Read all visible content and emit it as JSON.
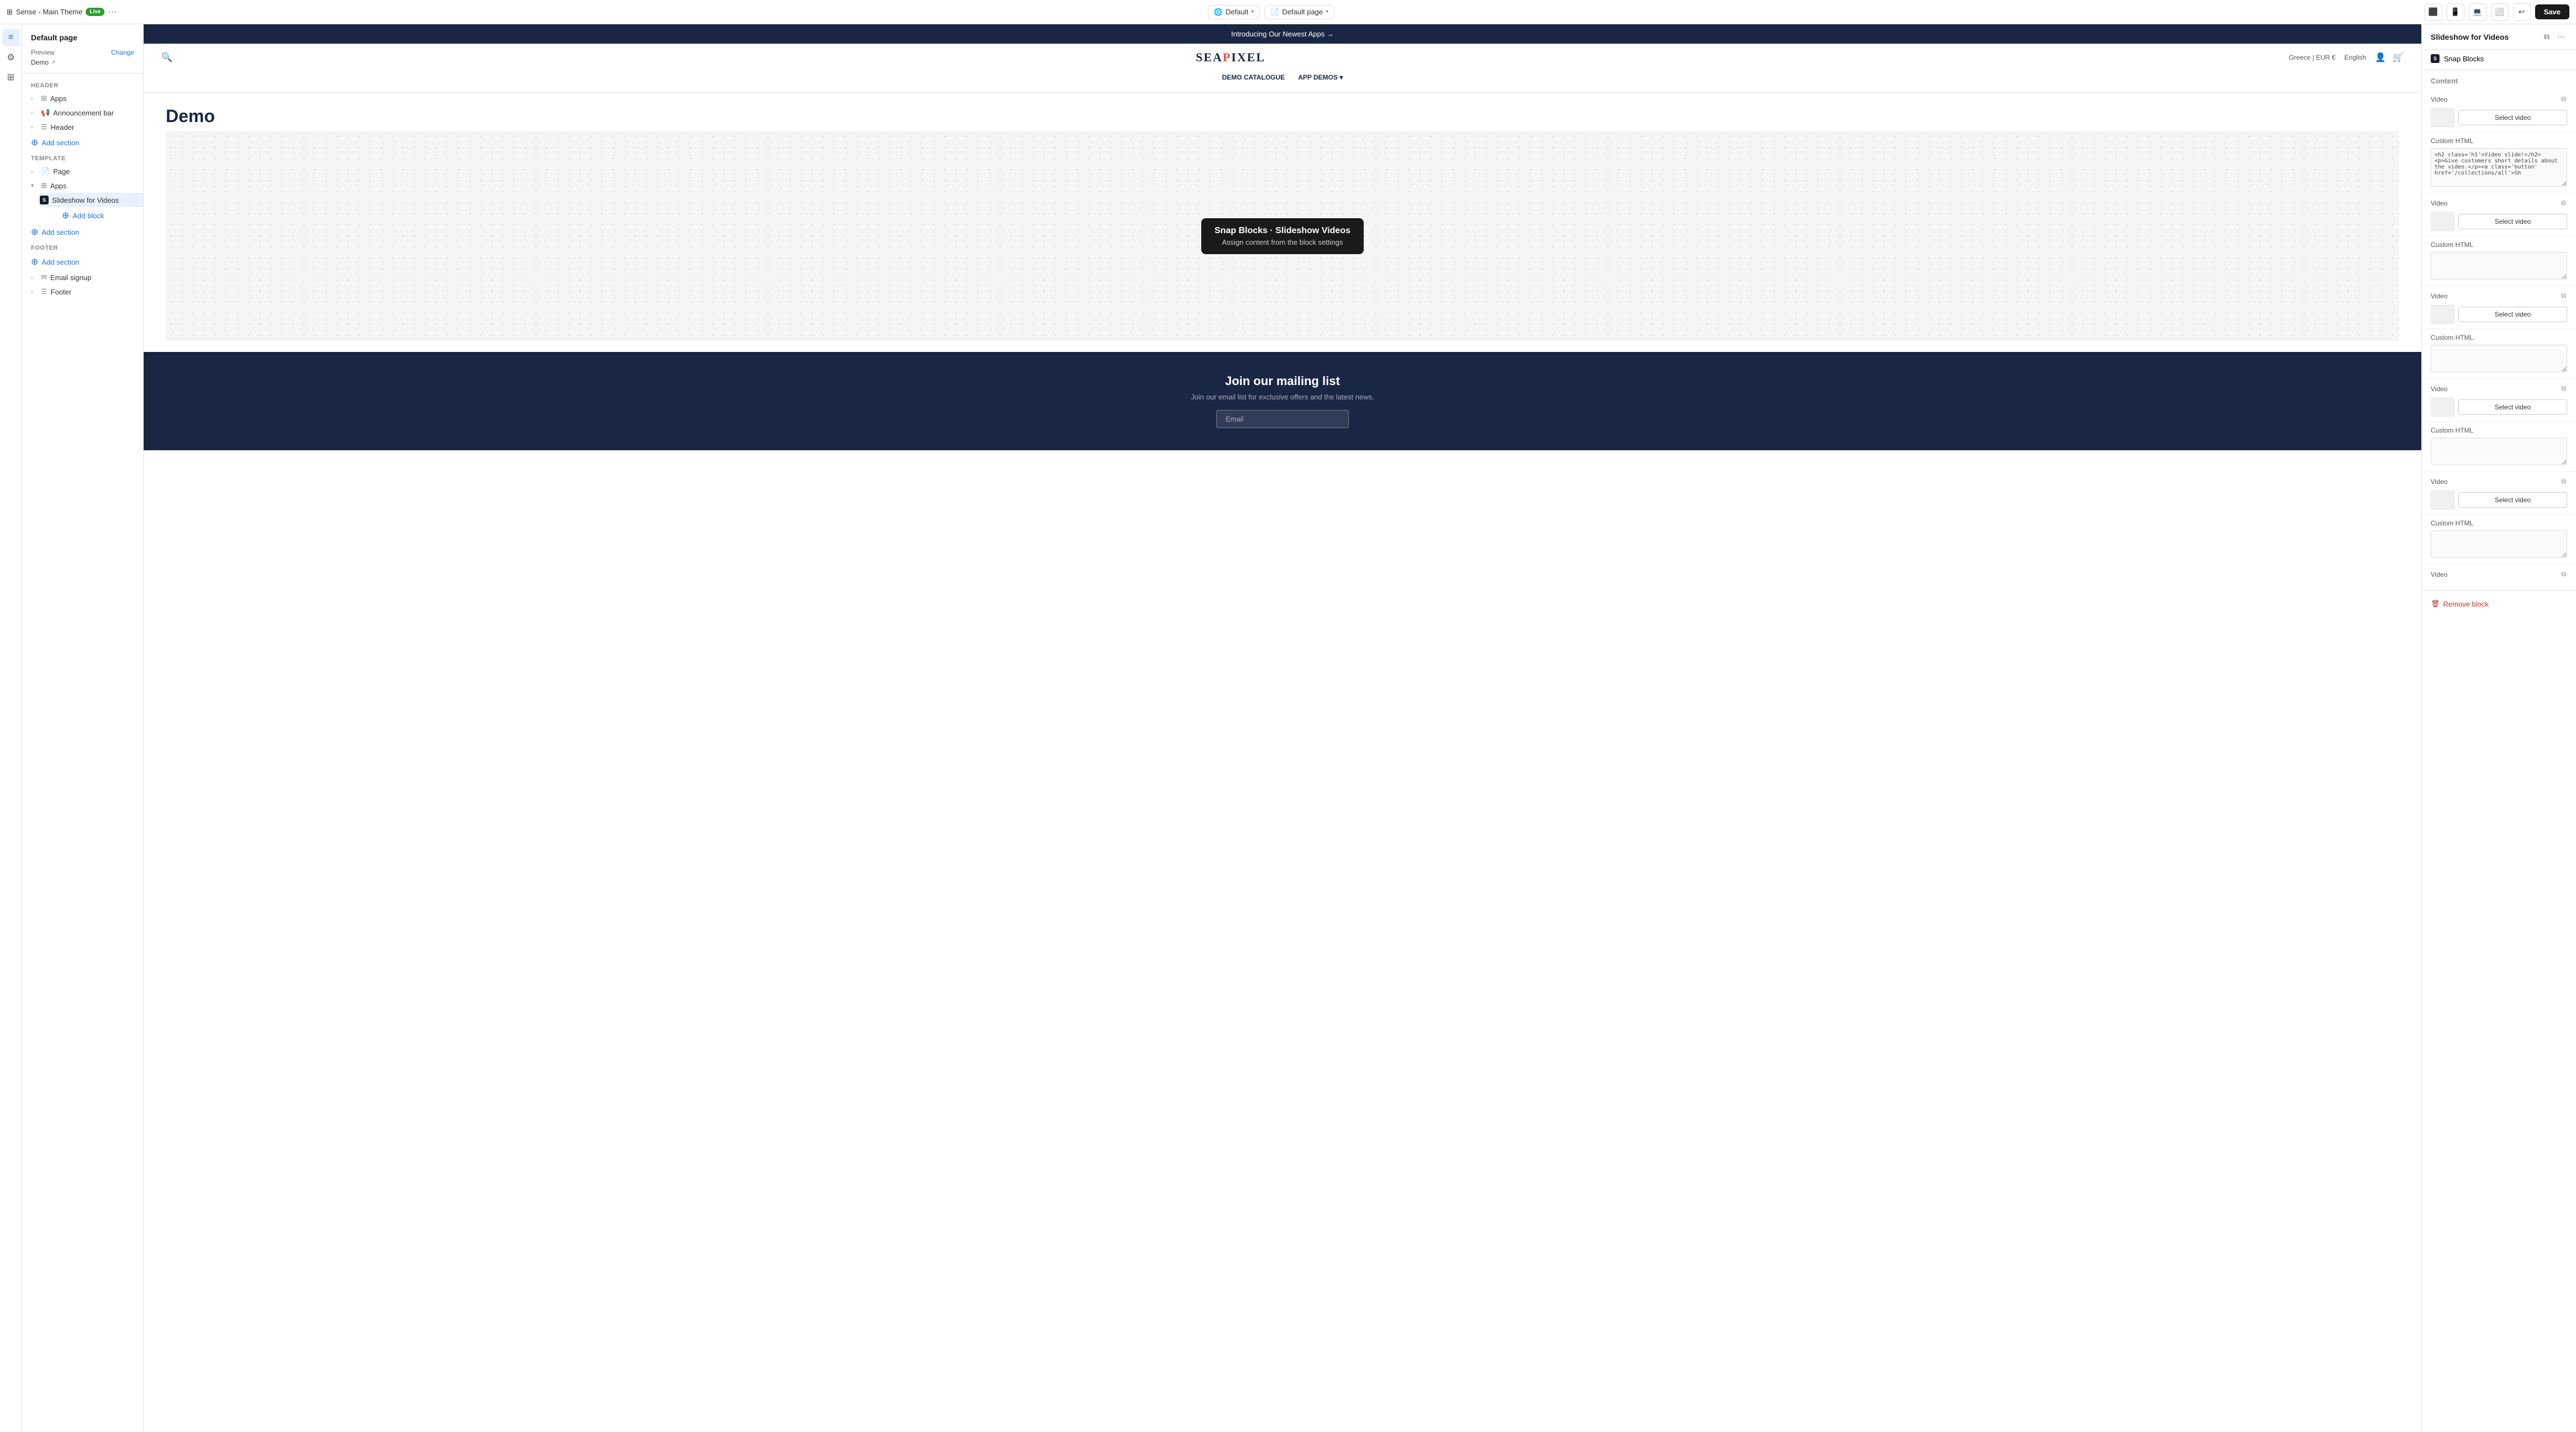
{
  "topbar": {
    "theme_name": "Sense - Main Theme",
    "live_label": "Live",
    "more_icon": "⋯",
    "default_label": "Default",
    "default_page_label": "Default page",
    "save_label": "Save",
    "undo_icon": "↩",
    "view_icons": [
      "⬛",
      "📱",
      "💻",
      "⬜"
    ]
  },
  "left_panel": {
    "title": "Default page",
    "preview_label": "Preview",
    "change_label": "Change",
    "demo_label": "Demo",
    "header_section": "Header",
    "apps_item": "Apps",
    "announcement_bar": "Announcement bar",
    "header_item": "Header",
    "add_section_1": "Add section",
    "template_label": "Template",
    "page_item": "Page",
    "apps_template": "Apps",
    "slideshow_videos": "Slideshow for Videos",
    "add_block": "Add block",
    "add_section_2": "Add section",
    "footer_label": "Footer",
    "add_section_footer": "Add section",
    "email_signup": "Email signup",
    "footer_item": "Footer"
  },
  "store": {
    "announcement": "Introducing Our Newest Apps →",
    "logo": "SEAPIXEL",
    "region": "Greece | EUR €",
    "language": "English",
    "nav": [
      "DEMO CATALOGUE",
      "APP DEMOS"
    ],
    "demo_title": "Demo",
    "slideshow_tooltip_title": "Snap Blocks · Slideshow Videos",
    "slideshow_tooltip_sub": "Assign content from the block settings",
    "mailing_title": "Join our mailing list",
    "mailing_sub": "Join our email list for exclusive offers and the latest news.",
    "email_placeholder": "Email"
  },
  "right_panel": {
    "title": "Slideshow for Videos",
    "snap_blocks_label": "Snap Blocks",
    "content_label": "Content",
    "video_label": "Video",
    "custom_html_label": "Custom HTML",
    "select_video_label": "Select video",
    "html_code": "<h2 class='h1'>Video slide!</h2><p>Give customers short details about the video.</p><a class='button' href='/collections/all'>Sh",
    "remove_block_label": "Remove block"
  }
}
